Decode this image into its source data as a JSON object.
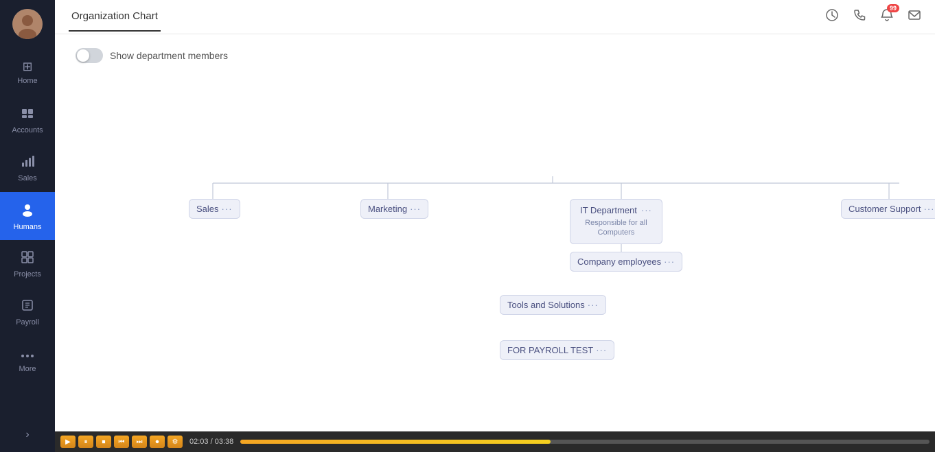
{
  "sidebar": {
    "nav_items": [
      {
        "id": "home",
        "label": "Home",
        "icon": "⊞",
        "active": false
      },
      {
        "id": "accounts",
        "label": "Accounts",
        "active": false,
        "icon": "⠿"
      },
      {
        "id": "sales",
        "label": "Sales",
        "active": false,
        "icon": "📊"
      },
      {
        "id": "humans",
        "label": "Humans",
        "active": true,
        "icon": "👤"
      },
      {
        "id": "projects",
        "label": "Projects",
        "active": false,
        "icon": "⬜"
      },
      {
        "id": "payroll",
        "label": "Payroll",
        "active": false,
        "icon": "🪪"
      },
      {
        "id": "more",
        "label": "More",
        "active": false,
        "icon": "···"
      }
    ],
    "expand_label": "›"
  },
  "topbar": {
    "tab_label": "Organization Chart",
    "icons": {
      "history": "🕐",
      "phone": "📞",
      "bell": "🔔",
      "mail": "✉"
    },
    "notification_count": "99"
  },
  "content": {
    "toggle_label": "Show department members",
    "toggle_on": false
  },
  "org_nodes": [
    {
      "id": "sales",
      "label": "Sales",
      "dots": "···"
    },
    {
      "id": "marketing",
      "label": "Marketing",
      "dots": "···"
    },
    {
      "id": "it_dept",
      "label": "IT Department",
      "sub": "Responsible for all Computers",
      "dots": "···"
    },
    {
      "id": "customer_support",
      "label": "Customer Support",
      "dots": "···"
    },
    {
      "id": "company_employees",
      "label": "Company employees",
      "dots": "···"
    },
    {
      "id": "tools_solutions",
      "label": "Tools and Solutions",
      "dots": "···"
    },
    {
      "id": "payroll_test",
      "label": "FOR PAYROLL TEST",
      "dots": "···"
    }
  ],
  "bottom_bar": {
    "time_left": "02:03",
    "time_right": "03:38",
    "separator": "/",
    "progress": 45
  }
}
